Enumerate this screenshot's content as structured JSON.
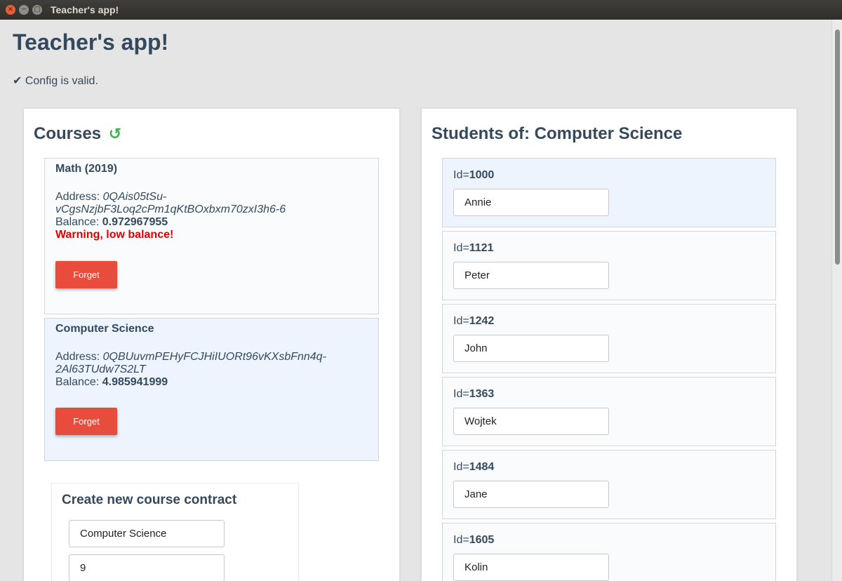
{
  "window": {
    "title": "Teacher's app!",
    "close_glyph": "×",
    "minimize_glyph": "−",
    "maximize_glyph": "□"
  },
  "page": {
    "title": "Teacher's app!",
    "config_status": "✔ Config is valid."
  },
  "courses": {
    "heading": "Courses",
    "refresh_icon": "↺",
    "items": [
      {
        "name": "Math (2019)",
        "address_label": "Address: ",
        "address": "0QAis05tSu-vCgsNzjbF3Loq2cPm1qKtBOxbxm70zxI3h6-6",
        "balance_label": "Balance: ",
        "balance": "0.972967955",
        "warning": "Warning, low balance!",
        "forget_label": "Forget"
      },
      {
        "name": "Computer Science",
        "address_label": "Address: ",
        "address": "0QBUuvmPEHyFCJHiIUORt96vKXsbFnn4q-2Al63TUdw7S2LT",
        "balance_label": "Balance: ",
        "balance": "4.985941999",
        "forget_label": "Forget"
      }
    ]
  },
  "create_course": {
    "title": "Create new course contract",
    "name_value": "Computer Science",
    "count_value": "9"
  },
  "students": {
    "heading": "Students of: Computer Science",
    "id_label": "Id=",
    "items": [
      {
        "id": "1000",
        "name": "Annie"
      },
      {
        "id": "1121",
        "name": "Peter"
      },
      {
        "id": "1242",
        "name": "John"
      },
      {
        "id": "1363",
        "name": "Wojtek"
      },
      {
        "id": "1484",
        "name": "Jane"
      },
      {
        "id": "1605",
        "name": "Kolin"
      }
    ]
  },
  "colors": {
    "heading": "#34495e",
    "button": "#e74c3c",
    "warning": "#e00000",
    "refresh": "#3bb54a",
    "selected_card": "#eef4fd"
  }
}
